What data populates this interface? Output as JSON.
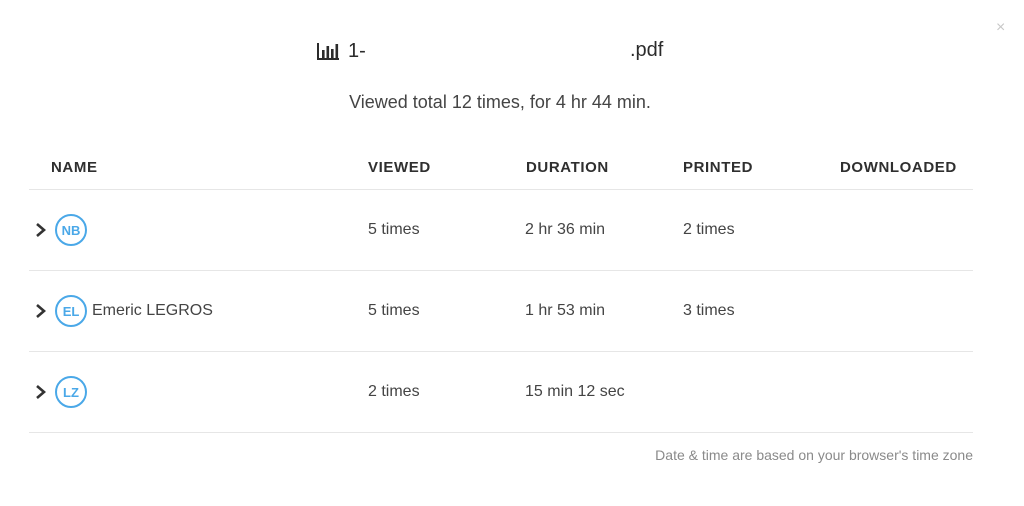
{
  "close_label": "×",
  "document": {
    "title_prefix": "1-",
    "title_suffix": ".pdf",
    "icon": "bar-chart-icon"
  },
  "summary": "Viewed total 12 times, for 4 hr 44 min.",
  "table": {
    "headers": {
      "name": "NAME",
      "viewed": "VIEWED",
      "duration": "DURATION",
      "printed": "PRINTED",
      "downloaded": "DOWNLOADED"
    },
    "rows": [
      {
        "initials": "NB",
        "name": "",
        "viewed": "5 times",
        "duration": "2 hr 36 min",
        "printed": "2 times",
        "downloaded": ""
      },
      {
        "initials": "EL",
        "name": "Emeric LEGROS",
        "viewed": "5 times",
        "duration": "1 hr 53 min",
        "printed": "3 times",
        "downloaded": ""
      },
      {
        "initials": "LZ",
        "name": "",
        "viewed": "2 times",
        "duration": "15 min 12 sec",
        "printed": "",
        "downloaded": ""
      }
    ]
  },
  "footnote": "Date & time are based on your browser's time zone",
  "colors": {
    "avatar_accent": "#4aa8e8",
    "divider": "#e6e6e6"
  }
}
